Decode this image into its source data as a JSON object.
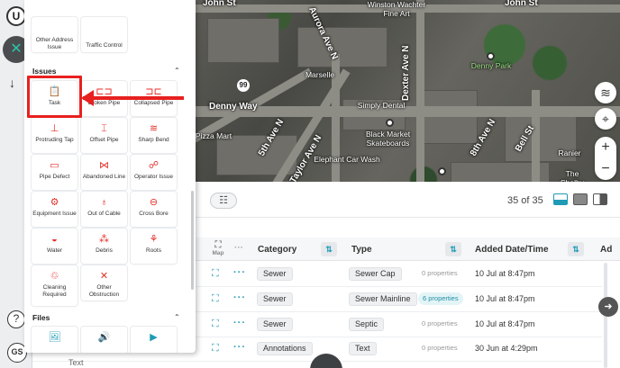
{
  "map": {
    "streets": [
      "John St",
      "John St",
      "Winston Wachter Fine Art",
      "Dexter Ave N",
      "Denny Way",
      "Aurora Ave N",
      "5th Ave N",
      "Taylor Ave N",
      "8th Ave N",
      "Bell St",
      "Elephant Car Wash",
      "Simply Dental",
      "Black Market Skateboards",
      "Denny Park",
      "Marselle",
      "Pizza Mart",
      "Ranier",
      "The Shelby"
    ],
    "route_badge": "99",
    "controls": {
      "layers_icon": "layers-icon",
      "locate_icon": "crosshair-icon",
      "zoom_in": "+",
      "zoom_out": "−"
    }
  },
  "rail": {
    "logo": "U",
    "close": "✕",
    "download": "↓",
    "help": "?",
    "user": "GS"
  },
  "feature_panel": {
    "top_items": [
      {
        "label": "Other Address Issue",
        "icon": "other-address-icon"
      },
      {
        "label": "Traffic Control",
        "icon": "traffic-control-icon"
      }
    ],
    "issues_title": "Issues",
    "files_title": "Files",
    "issues": [
      {
        "label": "Task",
        "icon": "clipboard-icon",
        "glyph": "📋"
      },
      {
        "label": "Broken Pipe",
        "icon": "broken-pipe-icon",
        "glyph": "⊏⊐"
      },
      {
        "label": "Collapsed Pipe",
        "icon": "collapsed-pipe-icon",
        "glyph": "⊐⊏"
      },
      {
        "label": "Protruding Tap",
        "icon": "protruding-tap-icon",
        "glyph": "⊥"
      },
      {
        "label": "Offset Pipe",
        "icon": "offset-pipe-icon",
        "glyph": "⌶"
      },
      {
        "label": "Sharp Bend",
        "icon": "sharp-bend-icon",
        "glyph": "≋"
      },
      {
        "label": "Pipe Defect",
        "icon": "pipe-defect-icon",
        "glyph": "▭"
      },
      {
        "label": "Abandoned Line",
        "icon": "abandoned-line-icon",
        "glyph": "⋈"
      },
      {
        "label": "Operator Issue",
        "icon": "operator-issue-icon",
        "glyph": "☍"
      },
      {
        "label": "Equipment Issue",
        "icon": "equipment-issue-icon",
        "glyph": "⚙"
      },
      {
        "label": "Out of Cable",
        "icon": "out-of-cable-icon",
        "glyph": "♁"
      },
      {
        "label": "Cross Bore",
        "icon": "cross-bore-icon",
        "glyph": "⊖"
      },
      {
        "label": "Water",
        "icon": "water-icon",
        "glyph": "◒"
      },
      {
        "label": "Debris",
        "icon": "debris-icon",
        "glyph": "⁂"
      },
      {
        "label": "Roots",
        "icon": "roots-icon",
        "glyph": "⚘"
      },
      {
        "label": "Cleaning Required",
        "icon": "cleaning-required-icon",
        "glyph": "♲"
      },
      {
        "label": "Other Obstruction",
        "icon": "other-obstruction-icon",
        "glyph": "✕"
      }
    ],
    "files": [
      {
        "label": "",
        "icon": "image-file-icon",
        "glyph": "🖼"
      },
      {
        "label": "",
        "icon": "audio-file-icon",
        "glyph": "🔊"
      },
      {
        "label": "",
        "icon": "video-file-icon",
        "glyph": "▶"
      }
    ]
  },
  "table": {
    "count": "35 of 35",
    "headers": {
      "map": "Map",
      "category": "Category",
      "type": "Type",
      "date": "Added Date/Time",
      "extra": "Ad"
    },
    "rows": [
      {
        "category": "Sewer",
        "type": "Sewer Cap",
        "properties": "0 properties",
        "date": "10 Jul at 8:47pm",
        "highlight": false
      },
      {
        "category": "Sewer",
        "type": "Sewer Mainline",
        "properties": "6 properties",
        "date": "10 Jul at 8:47pm",
        "highlight": true
      },
      {
        "category": "Sewer",
        "type": "Septic",
        "properties": "0 properties",
        "date": "10 Jul at 8:47pm",
        "highlight": false
      },
      {
        "category": "Annotations",
        "type": "Text",
        "properties": "0 properties",
        "date": "30 Jun at 4:29pm",
        "highlight": false
      }
    ],
    "ghost_row": "Text"
  },
  "colors": {
    "accent": "#1f9bb5",
    "highlight": "#e8201f",
    "issue_icon": "#e4312b"
  }
}
